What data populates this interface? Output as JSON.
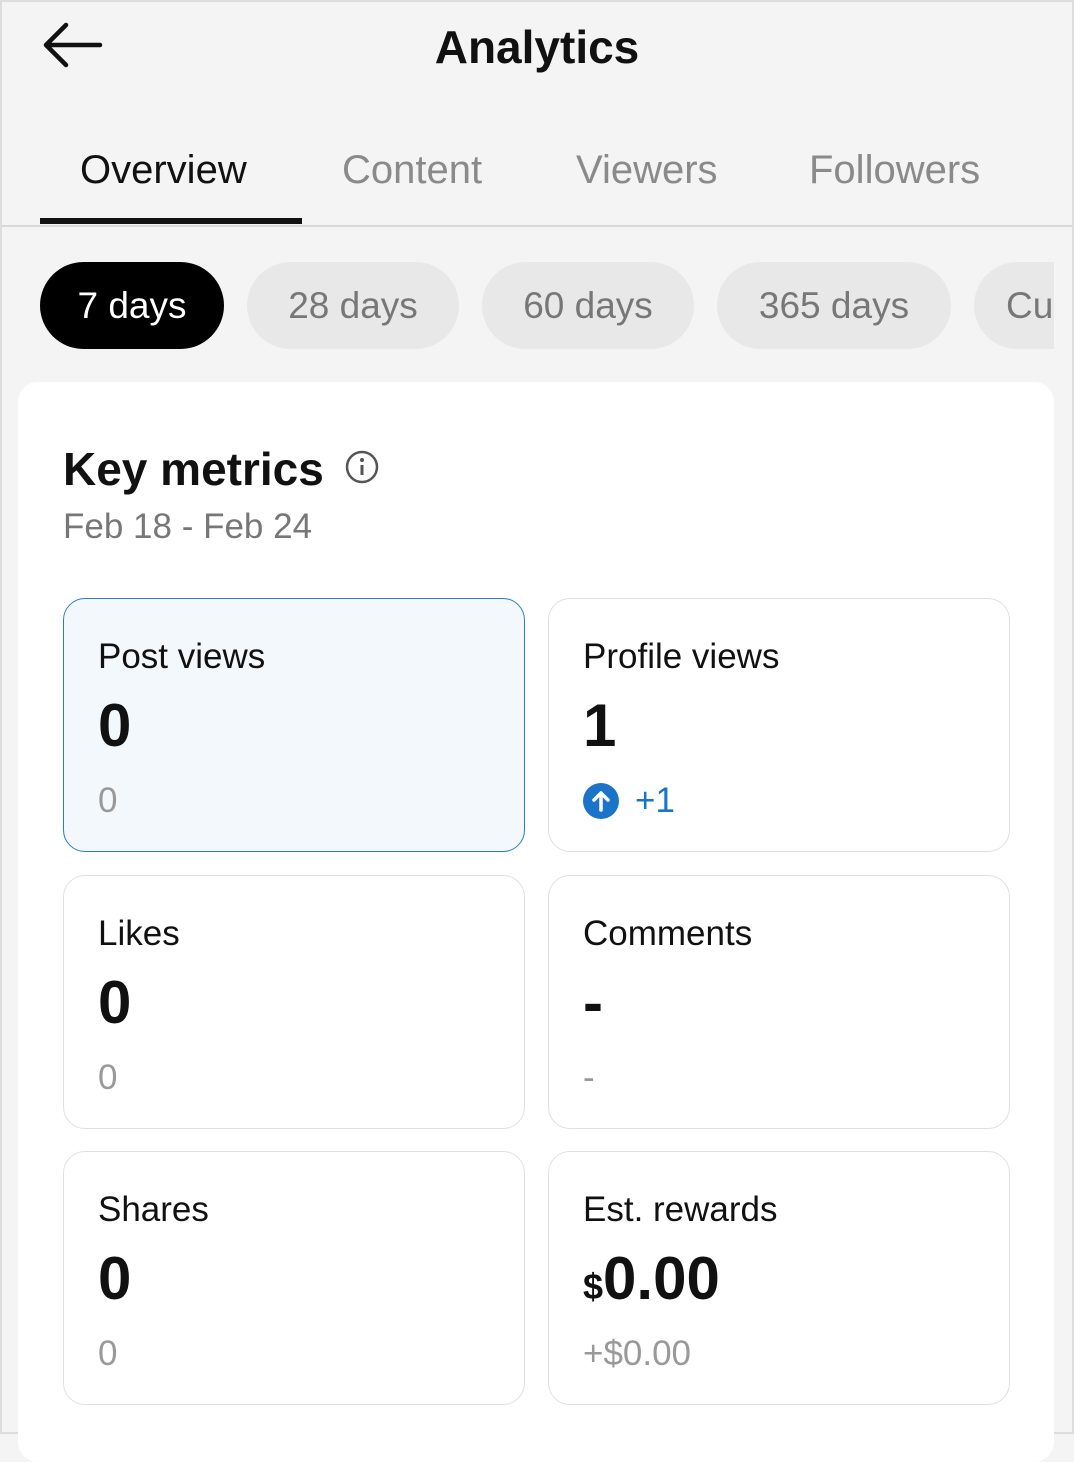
{
  "header": {
    "title": "Analytics",
    "back_icon": "arrow-left-icon"
  },
  "tabs": [
    {
      "label": "Overview",
      "active": true
    },
    {
      "label": "Content"
    },
    {
      "label": "Viewers"
    },
    {
      "label": "Followers"
    }
  ],
  "ranges": [
    {
      "label": "7 days",
      "active": true
    },
    {
      "label": "28 days"
    },
    {
      "label": "60 days"
    },
    {
      "label": "365 days"
    },
    {
      "label": "Cu"
    }
  ],
  "key_metrics": {
    "title": "Key metrics",
    "info_icon": "info-icon",
    "date_range": "Feb 18 - Feb 24",
    "metrics": [
      {
        "label": "Post views",
        "value": "0",
        "change": "0",
        "selected": true
      },
      {
        "label": "Profile views",
        "value": "1",
        "change": "+1",
        "trend": "up",
        "trend_color": "#1a74c9"
      },
      {
        "label": "Likes",
        "value": "0",
        "change": "0"
      },
      {
        "label": "Comments",
        "value": "-",
        "change": "-"
      },
      {
        "label": "Shares",
        "value": "0",
        "change": "0"
      },
      {
        "label": "Est. rewards",
        "currency": "$",
        "value": "0.00",
        "change": "+$0.00"
      }
    ]
  }
}
